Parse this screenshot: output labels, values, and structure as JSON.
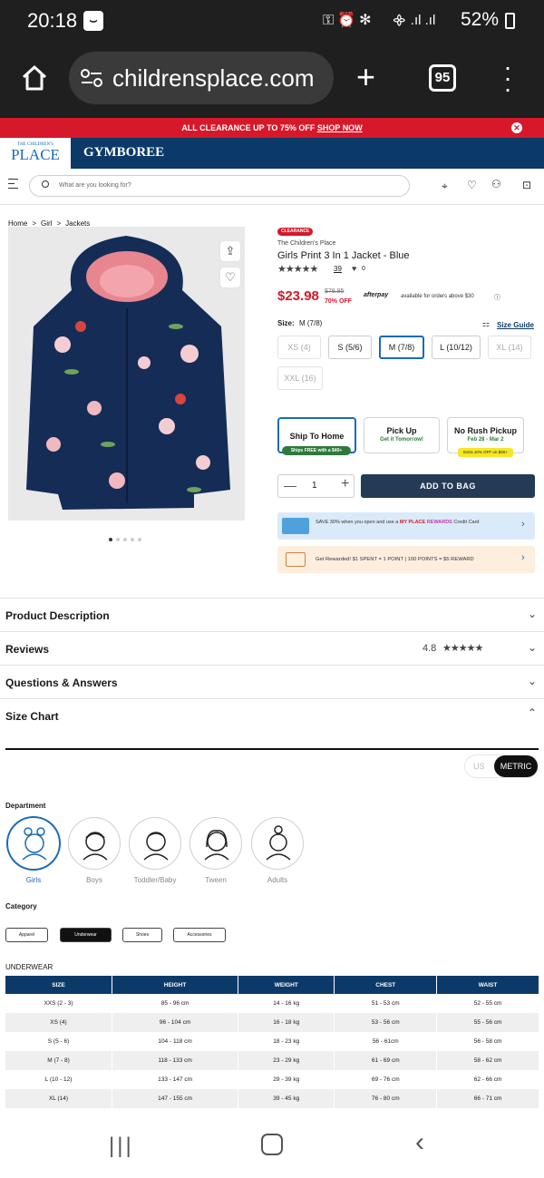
{
  "statusbar": {
    "time": "20:18",
    "battery": "52%"
  },
  "browser": {
    "url": "childrensplace.com",
    "tabs": "95"
  },
  "promo": {
    "text": "ALL CLEARANCE UP TO 75% OFF ",
    "link": "SHOP NOW"
  },
  "brands": {
    "tcp_small": "THE CHILDREN'S",
    "tcp_big": "PLACE",
    "gymboree": "GYMBOREE"
  },
  "search": {
    "placeholder": "What are you looking for?"
  },
  "breadcrumb": [
    "Home",
    "Girl",
    "Jackets"
  ],
  "product": {
    "badge": "CLEARANCE",
    "brand": "The Children's Place",
    "title": "Girls Print 3 In 1 Jacket - Blue",
    "review_count": "39",
    "favorites": "0",
    "price": "$23.98",
    "old_price": "$79.95",
    "discount": "70% OFF",
    "afterpay": "afterpay",
    "afterpay_text": "available for orders above $30",
    "size_label": "Size:",
    "size_value": "M (7/8)",
    "size_guide": "Size Guide",
    "sizes": [
      "XS (4)",
      "S (5/6)",
      "M (7/8)",
      "L (10/12)",
      "XL (14)",
      "XXL (16)"
    ],
    "ship": {
      "title": "Ship To Home",
      "tag": "Ships FREE with a $40+"
    },
    "pickup": {
      "title": "Pick Up",
      "sub": "Get it Tomorrow!"
    },
    "norush": {
      "title": "No Rush Pickup",
      "sub": "Feb 28 - Mar 2",
      "tag": "Extra 10% OFF on $50+"
    },
    "qty": "1",
    "add_to_bag": "ADD TO BAG",
    "card_promo_a": "SAVE 30% when you open and use a ",
    "card_promo_b": "MY PLACE ",
    "card_promo_c": "REWARDS",
    "card_promo_d": " Credit Card",
    "rewards_promo": "Get Rewarded! $1 SPENT = 1 POINT | 100 POINTS = $5 REWARD"
  },
  "accordion": {
    "desc": "Product Description",
    "reviews": "Reviews",
    "rating": "4.8",
    "qa": "Questions & Answers",
    "size_chart": "Size Chart"
  },
  "units": {
    "us": "US",
    "metric": "METRIC"
  },
  "department": {
    "label": "Department",
    "items": [
      "Girls",
      "Boys",
      "Toddler/Baby",
      "Tween",
      "Adults"
    ]
  },
  "category": {
    "label": "Category",
    "items": [
      "Apparel",
      "Underwear",
      "Shoes",
      "Accessories"
    ]
  },
  "table": {
    "title": "UNDERWEAR",
    "headers": [
      "SIZE",
      "HEIGHT",
      "WEIGHT",
      "CHEST",
      "WAIST"
    ],
    "rows": [
      [
        "XXS (2 - 3)",
        "85 - 96 cm",
        "14 - 16 kg",
        "51 - 53 cm",
        "52 - 55 cm"
      ],
      [
        "XS (4)",
        "96 - 104 cm",
        "16 - 18 kg",
        "53 - 56 cm",
        "55 - 56 cm"
      ],
      [
        "S (5 - 6)",
        "104 - 118 cm",
        "18 - 23 kg",
        "56 - 61cm",
        "56 - 58 cm"
      ],
      [
        "M (7 - 8)",
        "118 - 133 cm",
        "23 - 29 kg",
        "61 - 69 cm",
        "58 - 62 cm"
      ],
      [
        "L (10 - 12)",
        "133 - 147 cm",
        "29 - 39 kg",
        "69 - 76 cm",
        "62 - 66 cm"
      ],
      [
        "XL (14)",
        "147 - 155 cm",
        "39 - 45 kg",
        "76 - 80 cm",
        "66 - 71 cm"
      ]
    ]
  }
}
